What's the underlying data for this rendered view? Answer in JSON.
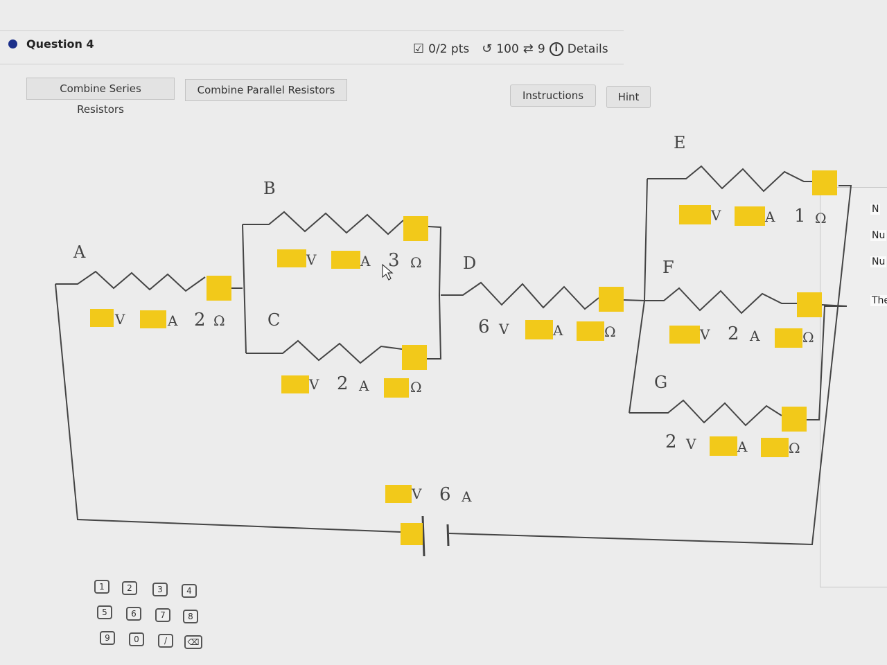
{
  "question": {
    "title": "Question 4"
  },
  "status": {
    "score": "0/2 pts",
    "attempts": "100",
    "retries": "9",
    "details": "Details"
  },
  "buttons": {
    "series": "Combine Series Resistors",
    "parallel": "Combine Parallel Resistors",
    "instructions": "Instructions",
    "hint": "Hint"
  },
  "circuit": {
    "resistor_labels": {
      "A": "A",
      "B": "B",
      "C": "C",
      "D": "D",
      "E": "E",
      "F": "F",
      "G": "G"
    },
    "units": {
      "volt": "V",
      "amp": "A",
      "ohm": "Ω"
    },
    "A": {
      "ohms": "2"
    },
    "B": {
      "ohms": "3"
    },
    "C": {
      "amps": "2"
    },
    "D": {
      "volts": "6"
    },
    "E": {
      "ohms": "1"
    },
    "F": {
      "amps": "2"
    },
    "G": {
      "volts": "2"
    },
    "battery": {
      "amps": "6"
    }
  },
  "side_panel": {
    "lines": [
      "N",
      "Nu",
      "Nu",
      "The"
    ]
  },
  "keypad": {
    "keys": [
      "1",
      "2",
      "3",
      "4",
      "5",
      "6",
      "7",
      "8",
      "9",
      "0",
      "/",
      "⌫"
    ]
  }
}
